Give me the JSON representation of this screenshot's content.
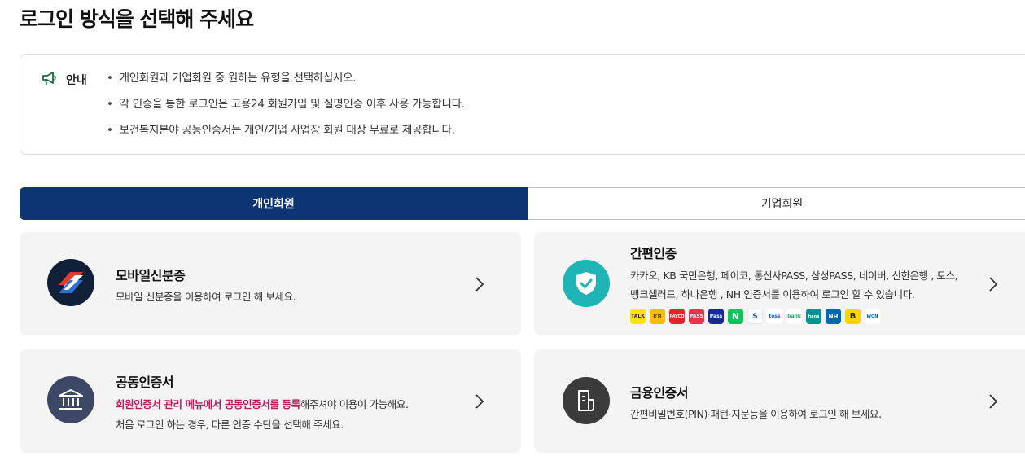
{
  "page": {
    "title": "로그인 방식을 선택해 주세요"
  },
  "notice": {
    "label": "안내",
    "icon": "megaphone-icon",
    "items": [
      "개인회원과 기업회원 중 원하는 유형을 선택하십시오.",
      "각 인증을 통한 로그인은 고용24 회원가입 및 실명인증 이후 사용 가능합니다.",
      "보건복지분야 공동인증서는 개인/기업 사업장 회원 대상 무료로 제공합니다."
    ]
  },
  "tabs": {
    "active": "개인회원",
    "inactive": "기업회원"
  },
  "colors": {
    "primary": "#0e3573",
    "highlight": "#c8175d",
    "card_bg": "#f4f4f4",
    "teal": "#1fb4b5"
  },
  "cards": {
    "mobile_id": {
      "title": "모바일신분증",
      "desc": "모바일 신분증을 이용하여 로그인 해 보세요."
    },
    "simple_auth": {
      "title": "간편인증",
      "desc_line1": "카카오, KB 국민은행, 페이코, 통신사PASS, 삼성PASS, 네이버, 신한은행 , 토스,",
      "desc_line2": "뱅크샐러드, 하나은행 , NH 인증서를 이용하여 로그인 할 수 있습니다.",
      "providers": [
        "TALK",
        "KB",
        "PAYCO",
        "PASS",
        "Pass",
        "N",
        "S",
        "toss",
        "bank",
        "hana",
        "NH",
        "B",
        "WON"
      ]
    },
    "joint_cert": {
      "title": "공동인증서",
      "desc_highlight": "회원인증서 관리 메뉴에서 공동인증서를 등록",
      "desc_rest": "해주셔야 이용이 가능해요.",
      "desc_line2": "처음 로그인 하는 경우, 다른 인증 수단을 선택해 주세요."
    },
    "financial_cert": {
      "title": "금융인증서",
      "desc": "간편비밀번호(PIN)·패턴·지문등을 이용하여 로그인 해 보세요."
    }
  }
}
